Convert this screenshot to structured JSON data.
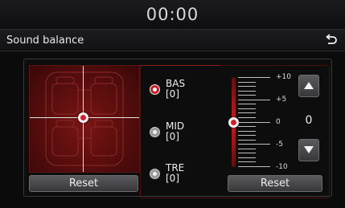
{
  "status_bar": {
    "clock": "00:00"
  },
  "header": {
    "title": "Sound balance",
    "back_icon": "back-arrow-icon"
  },
  "balance_fader": {
    "position": "center",
    "reset_label": "Reset"
  },
  "tone": {
    "items": [
      {
        "id": "bass",
        "label": "BAS",
        "value": "[0]",
        "selected": true
      },
      {
        "id": "mid",
        "label": "MID",
        "value": "[0]",
        "selected": false
      },
      {
        "id": "treble",
        "label": "TRE",
        "value": "[0]",
        "selected": false
      }
    ],
    "scale_labels": [
      "+10",
      "+5",
      "0",
      "-5",
      "-10"
    ],
    "current_value": "0",
    "level": 0,
    "range": [
      -10,
      10
    ],
    "reset_label": "Reset",
    "accent_color": "#d31f2a"
  }
}
